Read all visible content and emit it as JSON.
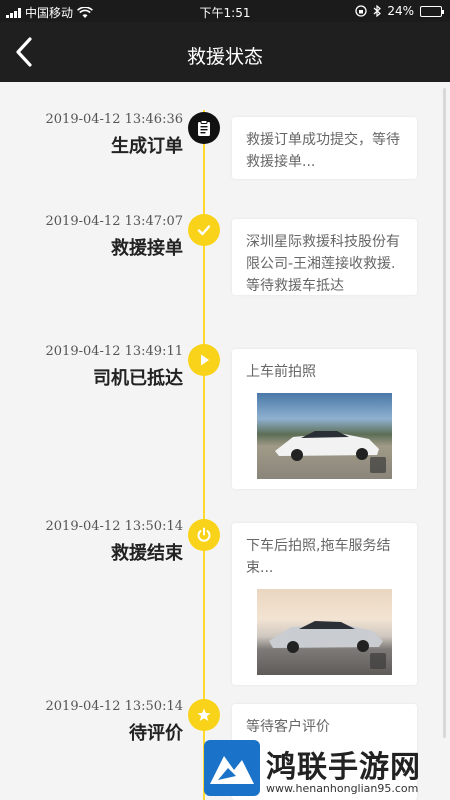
{
  "status_bar": {
    "carrier": "中国移动",
    "time": "下午1:51",
    "battery": "24%",
    "battery_level": 0.24
  },
  "nav": {
    "title": "救援状态"
  },
  "timeline": [
    {
      "time": "2019-04-12 13:46:36",
      "label": "生成订单",
      "icon": "clipboard-icon",
      "text": "救援订单成功提交，等待救援接单..."
    },
    {
      "time": "2019-04-12 13:47:07",
      "label": "救援接单",
      "icon": "check-icon",
      "text": "深圳星际救援科技股份有限公司-王湘莲接收救援.等待救援车抵达"
    },
    {
      "time": "2019-04-12 13:49:11",
      "label": "司机已抵达",
      "icon": "flag-icon",
      "text": "上车前拍照"
    },
    {
      "time": "2019-04-12 13:50:14",
      "label": "救援结束",
      "icon": "power-icon",
      "text": "下车后拍照,拖车服务结束..."
    },
    {
      "time": "2019-04-12 13:50:14",
      "label": "待评价",
      "icon": "star-icon",
      "text": "等待客户评价"
    }
  ],
  "colors": {
    "accent": "#f9d319",
    "header": "#1f1f1f",
    "background": "#f4f4f4"
  },
  "watermark": {
    "title": "鸿联手游网",
    "url": "www.henanhonglian95.com"
  }
}
